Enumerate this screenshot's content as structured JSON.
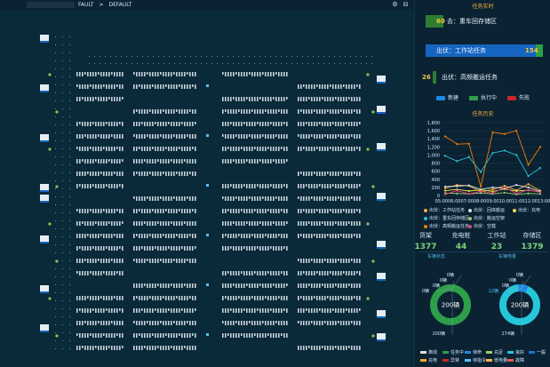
{
  "breadcrumb": {
    "item1": "FAULT",
    "sep": ">",
    "item2": "DEFAULT"
  },
  "colors": {
    "green": "#2e9e4a",
    "blue": "#1976d2",
    "red": "#c62828",
    "orange": "#f5a623",
    "accent": "#f5b041"
  },
  "task_panel": {
    "title": "任务实时",
    "rows": [
      {
        "num": "60",
        "label": "去：重车回存储区",
        "fill": 0.14,
        "color": "#2e7d32"
      },
      {
        "num": "154",
        "label": "出伏：工作站任务",
        "fill": 0.98,
        "color": "#1565c0"
      },
      {
        "num": "26",
        "label": "出伏：高频搬运任务",
        "fill": 0.04,
        "color": "#2e7d32"
      }
    ],
    "legend": [
      {
        "label": "新建",
        "color": "#1e88e5"
      },
      {
        "label": "执行中",
        "color": "#2e9e4a"
      },
      {
        "label": "失败",
        "color": "#c62828"
      }
    ]
  },
  "history_chart": {
    "title": "任务历史",
    "chart_data": {
      "type": "line",
      "title": "任务历史",
      "categories": [
        "05:00",
        "06:00",
        "07:00",
        "08:00",
        "09:00",
        "10:00",
        "11:00",
        "12:00",
        "13:00"
      ],
      "category_labels": "05:0006:0007:0008:0009:0010:0011:0012:0013:00",
      "y_ticks": [
        "1,800",
        "1,600",
        "1,400",
        "1,200",
        "1,000",
        "800",
        "600",
        "400",
        "200",
        "0"
      ],
      "ylim": [
        0,
        1800
      ],
      "series": [
        {
          "name": "出伏：工作站任务",
          "color": "#f5b041",
          "values": [
            180,
            260,
            240,
            90,
            150,
            240,
            130,
            280,
            120
          ]
        },
        {
          "name": "出伏：回库搬运",
          "color": "#e0e0e0",
          "values": [
            220,
            230,
            250,
            150,
            200,
            180,
            260,
            200,
            100
          ]
        },
        {
          "name": "出伏：充电",
          "color": "#f4e04d",
          "values": [
            120,
            150,
            110,
            140,
            100,
            160,
            110,
            130,
            90
          ]
        },
        {
          "name": "出伏：重车回存储区",
          "color": "#26c6da",
          "values": [
            980,
            850,
            950,
            580,
            1050,
            1110,
            1000,
            480,
            680
          ]
        },
        {
          "name": "出伏：搬运空架",
          "color": "#9ccc65",
          "values": [
            60,
            50,
            40,
            60,
            40,
            70,
            30,
            50,
            40
          ]
        },
        {
          "name": "出伏：高频搬运任务",
          "color": "#f57c00",
          "values": [
            1460,
            1270,
            1280,
            220,
            1560,
            1520,
            1600,
            760,
            1200
          ]
        },
        {
          "name": "出伏：空载",
          "color": "#ec407a",
          "values": [
            30,
            120,
            40,
            100,
            60,
            200,
            50,
            140,
            80
          ]
        }
      ]
    }
  },
  "stats": [
    {
      "label": "货架",
      "value": "1377"
    },
    {
      "label": "充电桩",
      "value": "44"
    },
    {
      "label": "工作站",
      "value": "23"
    },
    {
      "label": "存储区",
      "value": "1379"
    }
  ],
  "vehicle_status": {
    "title": "车辆状态",
    "center": "200辆",
    "callouts": [
      "0辆",
      "0辆",
      "0辆",
      "0辆",
      "200辆"
    ]
  },
  "vehicle_power": {
    "title": "车辆电量",
    "center": "200辆",
    "callouts": [
      "0辆",
      "0辆",
      "0辆",
      "12辆",
      "174辆"
    ]
  },
  "bottom_legend": [
    {
      "label": "离线",
      "color": "#e0e0e0"
    },
    {
      "label": "任务中",
      "color": "#2e9e4a"
    },
    {
      "label": "待命",
      "color": "#1e88e5"
    },
    {
      "label": "充足",
      "color": "#9ccc65"
    },
    {
      "label": "良好",
      "color": "#26c6da"
    },
    {
      "label": "一般",
      "color": "#1976d2"
    },
    {
      "label": "充电",
      "color": "#f5a623"
    },
    {
      "label": "异常",
      "color": "#c62828"
    },
    {
      "label": "待指令",
      "color": "#4fc3f7"
    },
    {
      "label": "低电量",
      "color": "#ffb74d"
    },
    {
      "label": "故障",
      "color": "#ef5350"
    }
  ]
}
